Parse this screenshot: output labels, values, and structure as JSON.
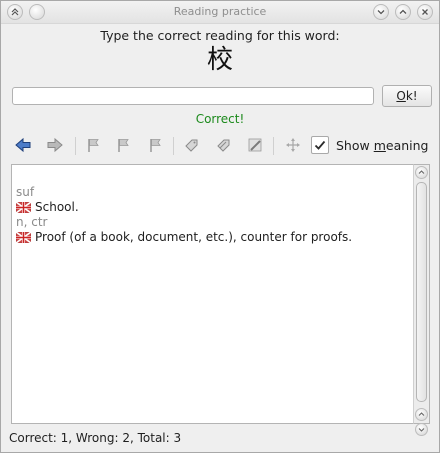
{
  "window": {
    "title": "Reading practice"
  },
  "quiz": {
    "prompt": "Type the correct reading for this word:",
    "word": "校",
    "answer_value": "",
    "ok_label_mnemonic": "O",
    "ok_label_rest": "k!",
    "result": "Correct!"
  },
  "toolbar": {
    "icons": [
      "back-arrow-icon",
      "forward-arrow-icon",
      "flag-icon",
      "flag-icon",
      "flag-icon",
      "tag-icon",
      "tag-edit-icon",
      "pencil-icon",
      "move-icon"
    ],
    "show_meaning_checked": true,
    "show_meaning_label_pre": "Show ",
    "show_meaning_label_mnemonic": "m",
    "show_meaning_label_post": "eaning"
  },
  "meanings": [
    {
      "pos": "suf",
      "text": "School."
    },
    {
      "pos": "n, ctr",
      "text": "Proof (of a book, document, etc.), counter for proofs."
    }
  ],
  "status": "Correct: 1, Wrong: 2, Total: 3",
  "colors": {
    "correct": "#1c8a1c",
    "accent_arrow": "#2a5aa8"
  }
}
